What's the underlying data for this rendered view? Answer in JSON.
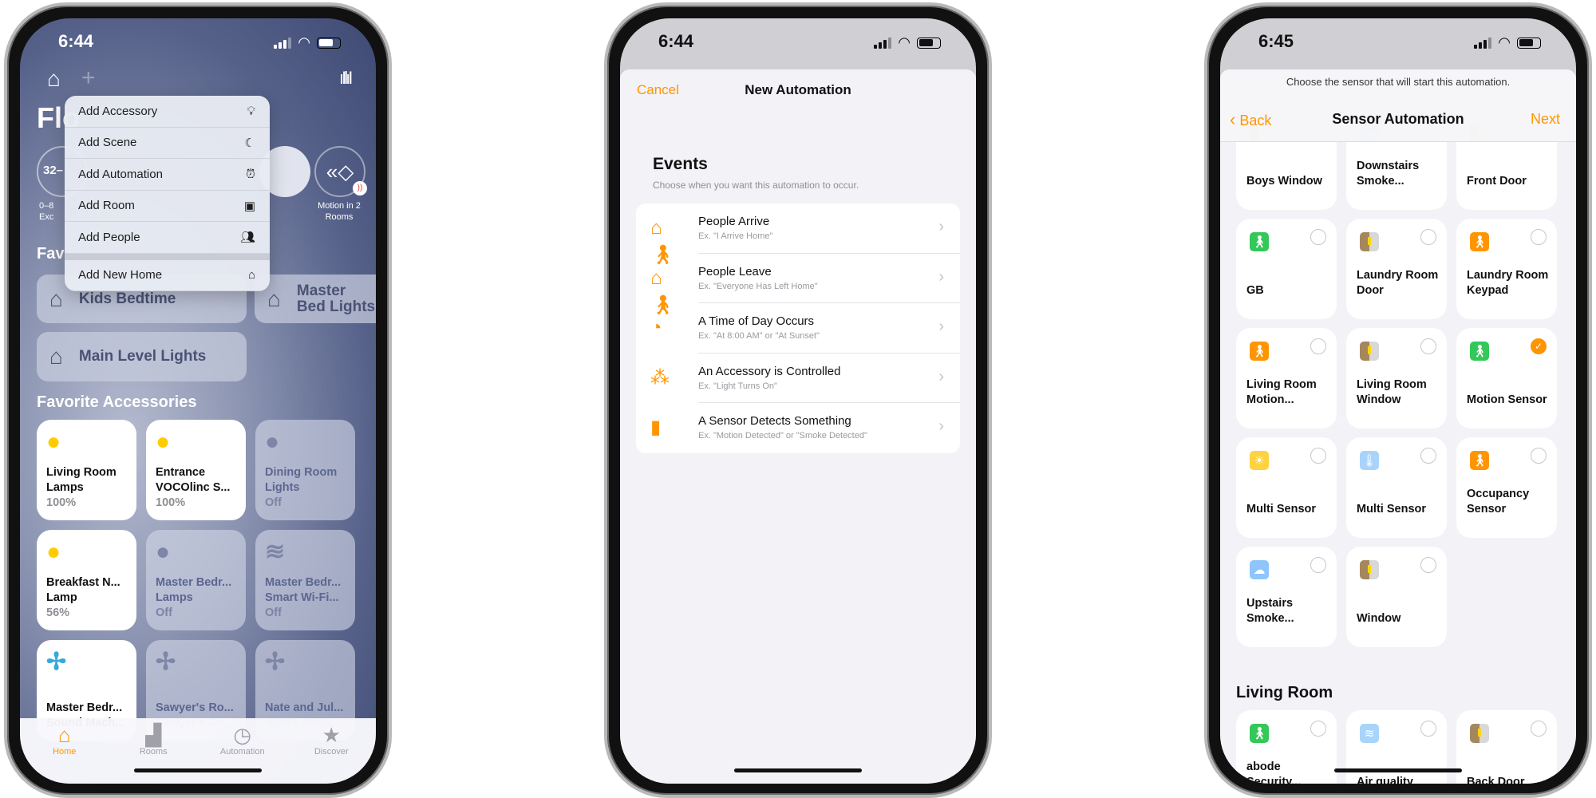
{
  "colors": {
    "accent": "#ff9500",
    "on_bulb": "#ffcc00",
    "off_text": "#5c6690"
  },
  "phone1": {
    "status": {
      "time": "6:44"
    },
    "title_partial": "Flo",
    "status_chips": [
      {
        "value": "32–",
        "sub1": "0–8",
        "sub2": "Exc"
      },
      {
        "label": "Motion in 2 Rooms"
      }
    ],
    "menu": [
      {
        "label": "Add Accessory",
        "icon": "lightbulb-icon"
      },
      {
        "label": "Add Scene",
        "icon": "scene-moon-icon"
      },
      {
        "label": "Add Automation",
        "icon": "alarm-clock-icon"
      },
      {
        "label": "Add Room",
        "icon": "room-icon"
      },
      {
        "label": "Add People",
        "icon": "people-icon"
      },
      {
        "label": "Add New Home",
        "icon": "house-icon"
      }
    ],
    "favorite_scenes_partial": "Fav",
    "scenes": [
      {
        "label": "Kids Bedtime"
      },
      {
        "label": "Master Bed Lights"
      },
      {
        "label": "Main Level Lights"
      }
    ],
    "favorite_accessories_title": "Favorite Accessories",
    "accessories": [
      {
        "name": "Living Room Lamps",
        "status": "100%",
        "on": true,
        "icon": "lightbulb-icon"
      },
      {
        "name": "Entrance VOCOlinc S...",
        "status": "100%",
        "on": true,
        "icon": "lightbulb-icon"
      },
      {
        "name": "Dining Room Lights",
        "status": "Off",
        "on": false,
        "icon": "lightbulb-icon"
      },
      {
        "name": "Breakfast N... Lamp",
        "status": "56%",
        "on": true,
        "icon": "lightbulb-icon"
      },
      {
        "name": "Master Bedr... Lamps",
        "status": "Off",
        "on": false,
        "icon": "lightbulb-icon"
      },
      {
        "name": "Master Bedr... Smart Wi-Fi...",
        "status": "Off",
        "on": false,
        "icon": "humidifier-icon"
      },
      {
        "name": "Master Bedr... Sound Mach...",
        "status": "",
        "on": true,
        "icon": "fan-icon"
      },
      {
        "name": "Sawyer's Ro... Sawyer's So...",
        "status": "",
        "on": false,
        "icon": "fan-icon"
      },
      {
        "name": "Nate and Jul... Nate's Soun...",
        "status": "",
        "on": false,
        "icon": "fan-icon"
      }
    ],
    "tabs": [
      {
        "label": "Home",
        "active": true
      },
      {
        "label": "Rooms"
      },
      {
        "label": "Automation"
      },
      {
        "label": "Discover"
      }
    ]
  },
  "phone2": {
    "status": {
      "time": "6:44"
    },
    "cancel": "Cancel",
    "title": "New Automation",
    "section_title": "Events",
    "section_sub": "Choose when you want this automation to occur.",
    "events": [
      {
        "title": "People Arrive",
        "sub": "Ex. \"I Arrive Home\"",
        "icon": "people-arrive-icon"
      },
      {
        "title": "People Leave",
        "sub": "Ex. \"Everyone Has Left Home\"",
        "icon": "people-leave-icon"
      },
      {
        "title": "A Time of Day Occurs",
        "sub": "Ex. \"At 8:00 AM\" or \"At Sunset\"",
        "icon": "clock-icon"
      },
      {
        "title": "An Accessory is Controlled",
        "sub": "Ex. \"Light Turns On\"",
        "icon": "accessory-network-icon"
      },
      {
        "title": "A Sensor Detects Something",
        "sub": "Ex. \"Motion Detected\" or \"Smoke Detected\"",
        "icon": "sensor-icon"
      }
    ]
  },
  "phone3": {
    "status": {
      "time": "6:45"
    },
    "prompt": "Choose the sensor that will start this automation.",
    "back": "Back",
    "title": "Sensor Automation",
    "next": "Next",
    "sensors": [
      {
        "name": "Boys Window",
        "icon": "door-sensor-icon"
      },
      {
        "name": "Downstairs Smoke...",
        "icon": "smoke-icon"
      },
      {
        "name": "Front Door",
        "icon": "door-sensor-icon"
      },
      {
        "name": "GB",
        "icon": "motion-green-icon"
      },
      {
        "name": "Laundry Room Door",
        "icon": "door-sensor-icon"
      },
      {
        "name": "Laundry Room Keypad",
        "icon": "motion-orange-icon"
      },
      {
        "name": "Living Room Motion...",
        "icon": "motion-orange-icon"
      },
      {
        "name": "Living Room Window",
        "icon": "door-sensor-icon"
      },
      {
        "name": "Motion Sensor",
        "icon": "motion-green-icon",
        "selected": true
      },
      {
        "name": "Multi Sensor",
        "icon": "light-sensor-icon"
      },
      {
        "name": "Multi Sensor",
        "icon": "temperature-icon"
      },
      {
        "name": "Occupancy Sensor",
        "icon": "motion-orange-icon"
      },
      {
        "name": "Upstairs Smoke...",
        "icon": "smoke-icon"
      },
      {
        "name": "Window",
        "icon": "door-sensor-icon"
      }
    ],
    "room_title": "Living Room",
    "room_sensors": [
      {
        "name": "abode Security...",
        "icon": "motion-green-icon"
      },
      {
        "name": "Air quality",
        "icon": "air-quality-icon"
      },
      {
        "name": "Back Door",
        "icon": "door-sensor-icon"
      }
    ]
  }
}
